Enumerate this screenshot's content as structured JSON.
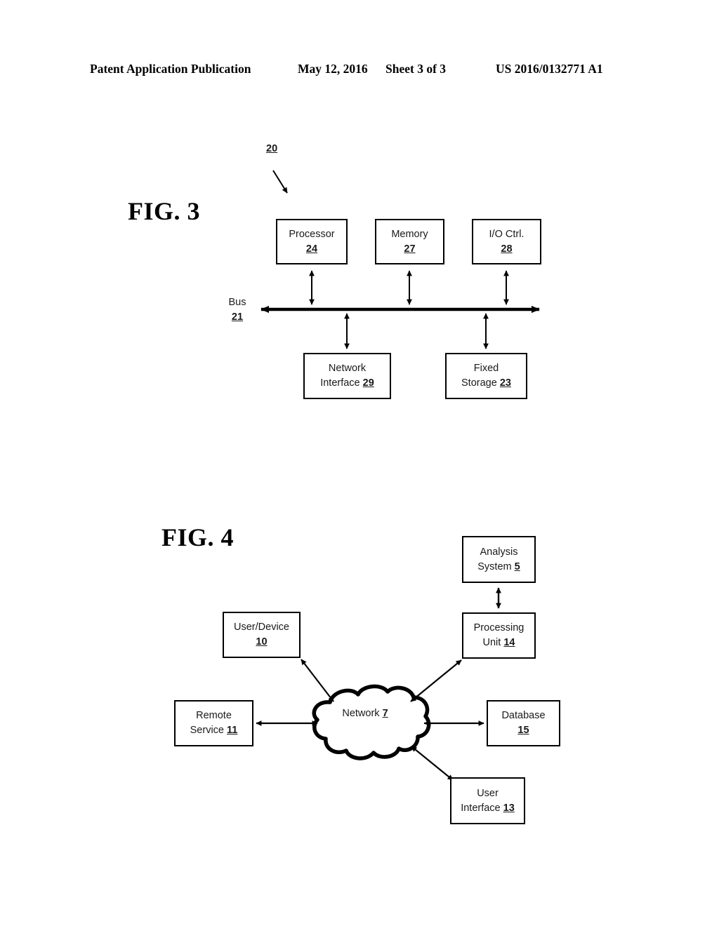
{
  "header": {
    "publication": "Patent Application Publication",
    "date": "May 12, 2016",
    "sheet": "Sheet 3 of 3",
    "patent_number": "US 2016/0132771 A1"
  },
  "figures": [
    {
      "id": "fig3",
      "title": "FIG. 3",
      "system_ref": "20",
      "bus": {
        "label": "Bus",
        "ref": "21"
      },
      "nodes": [
        {
          "name": "processor",
          "line1": "Processor",
          "line2": "",
          "ref": "24"
        },
        {
          "name": "memory",
          "line1": "Memory",
          "line2": "",
          "ref": "27"
        },
        {
          "name": "io-controller",
          "line1": "I/O Ctrl.",
          "line2": "",
          "ref": "28"
        },
        {
          "name": "network-interface",
          "line1": "Network",
          "line2": "Interface",
          "ref": "29"
        },
        {
          "name": "fixed-storage",
          "line1": "Fixed",
          "line2": "Storage",
          "ref": "23"
        }
      ]
    },
    {
      "id": "fig4",
      "title": "FIG. 4",
      "cloud": {
        "line1": "Network",
        "ref": "7"
      },
      "nodes": [
        {
          "name": "analysis-system",
          "line1": "Analysis",
          "line2": "System",
          "ref": "5"
        },
        {
          "name": "processing-unit",
          "line1": "Processing",
          "line2": "Unit",
          "ref": "14"
        },
        {
          "name": "user-device",
          "line1": "User/Device",
          "line2": "",
          "ref": "10"
        },
        {
          "name": "remote-service",
          "line1": "Remote",
          "line2": "Service",
          "ref": "11"
        },
        {
          "name": "database",
          "line1": "Database",
          "line2": "",
          "ref": "15"
        },
        {
          "name": "user-interface",
          "line1": "User",
          "line2": "Interface",
          "ref": "13"
        }
      ]
    }
  ],
  "colors": {
    "ink": "#000000",
    "text": "#1a1a1a",
    "paper": "#ffffff"
  }
}
